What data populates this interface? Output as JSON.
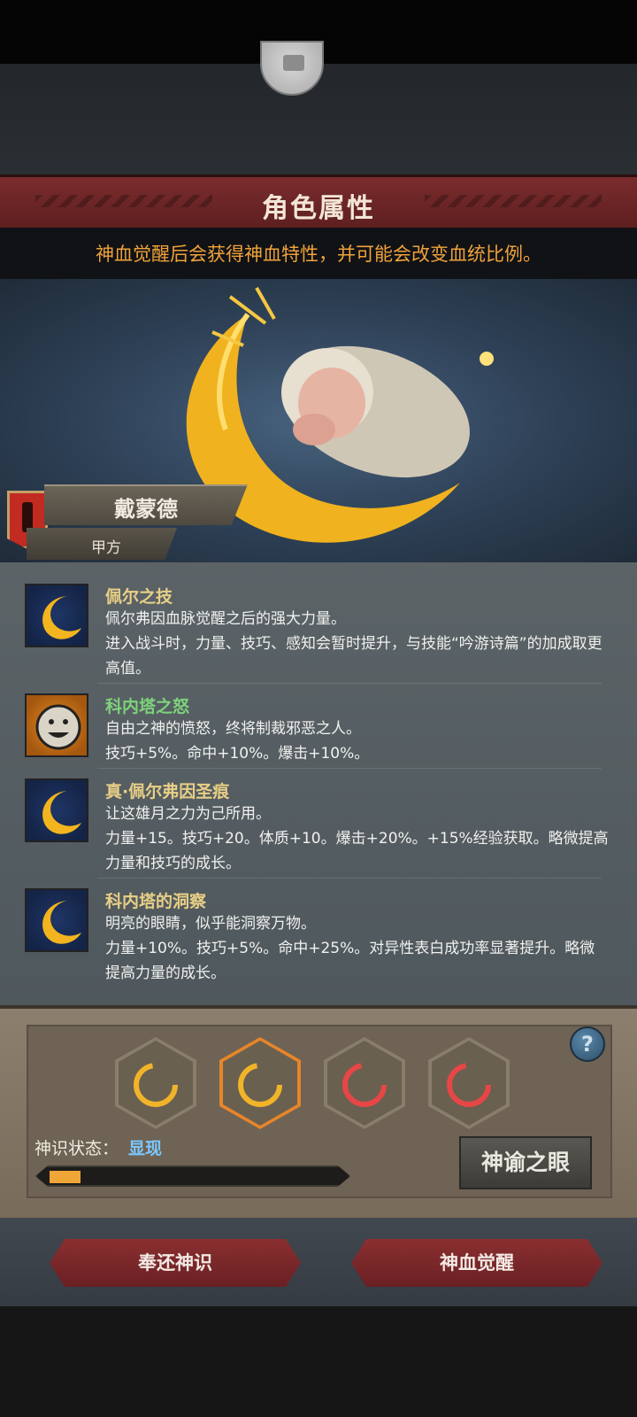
{
  "header": {
    "title": "角色属性"
  },
  "banner": {
    "text": "神血觉醒后会获得神血特性，并可能会改变血统比例。"
  },
  "character": {
    "name": "戴蒙德",
    "faction": "甲方"
  },
  "traits": [
    {
      "name": "佩尔之技",
      "name_color": "#e8cf86",
      "icon": "crescent-moon-icon",
      "desc": "佩尔弗因血脉觉醒之后的强大力量。\n进入战斗时，力量、技巧、感知会暂时提升，与技能“吟游诗篇”的加成取更高值。"
    },
    {
      "name": "科内塔之怒",
      "name_color": "#7ed27b",
      "icon": "smiley-face-icon",
      "desc": "自由之神的愤怒，终将制裁邪恶之人。\n技巧+5%。命中+10%。爆击+10%。"
    },
    {
      "name": "真·佩尔弗因圣痕",
      "name_color": "#e8cf86",
      "icon": "crescent-moon-icon",
      "desc": "让这雄月之力为己所用。\n力量+15。技巧+20。体质+10。爆击+20%。+15%经验获取。略微提高力量和技巧的成长。"
    },
    {
      "name": "科内塔的洞察",
      "name_color": "#e8cf86",
      "icon": "crescent-moon-icon",
      "desc": "明亮的眼睛，似乎能洞察万物。\n力量+10%。技巧+5%。命中+25%。对异性表白成功率显著提升。略微提高力量的成长。"
    }
  ],
  "divine": {
    "slots": [
      {
        "color": "gold",
        "active": false
      },
      {
        "color": "gold",
        "active": true
      },
      {
        "color": "red",
        "active": false
      },
      {
        "color": "red",
        "active": false
      }
    ],
    "state_label": "神识状态：",
    "state_value": "显现",
    "progress": 0.11,
    "oracle_button": "神谕之眼",
    "help": "?"
  },
  "buttons": {
    "return": "奉还神识",
    "awaken": "神血觉醒"
  }
}
